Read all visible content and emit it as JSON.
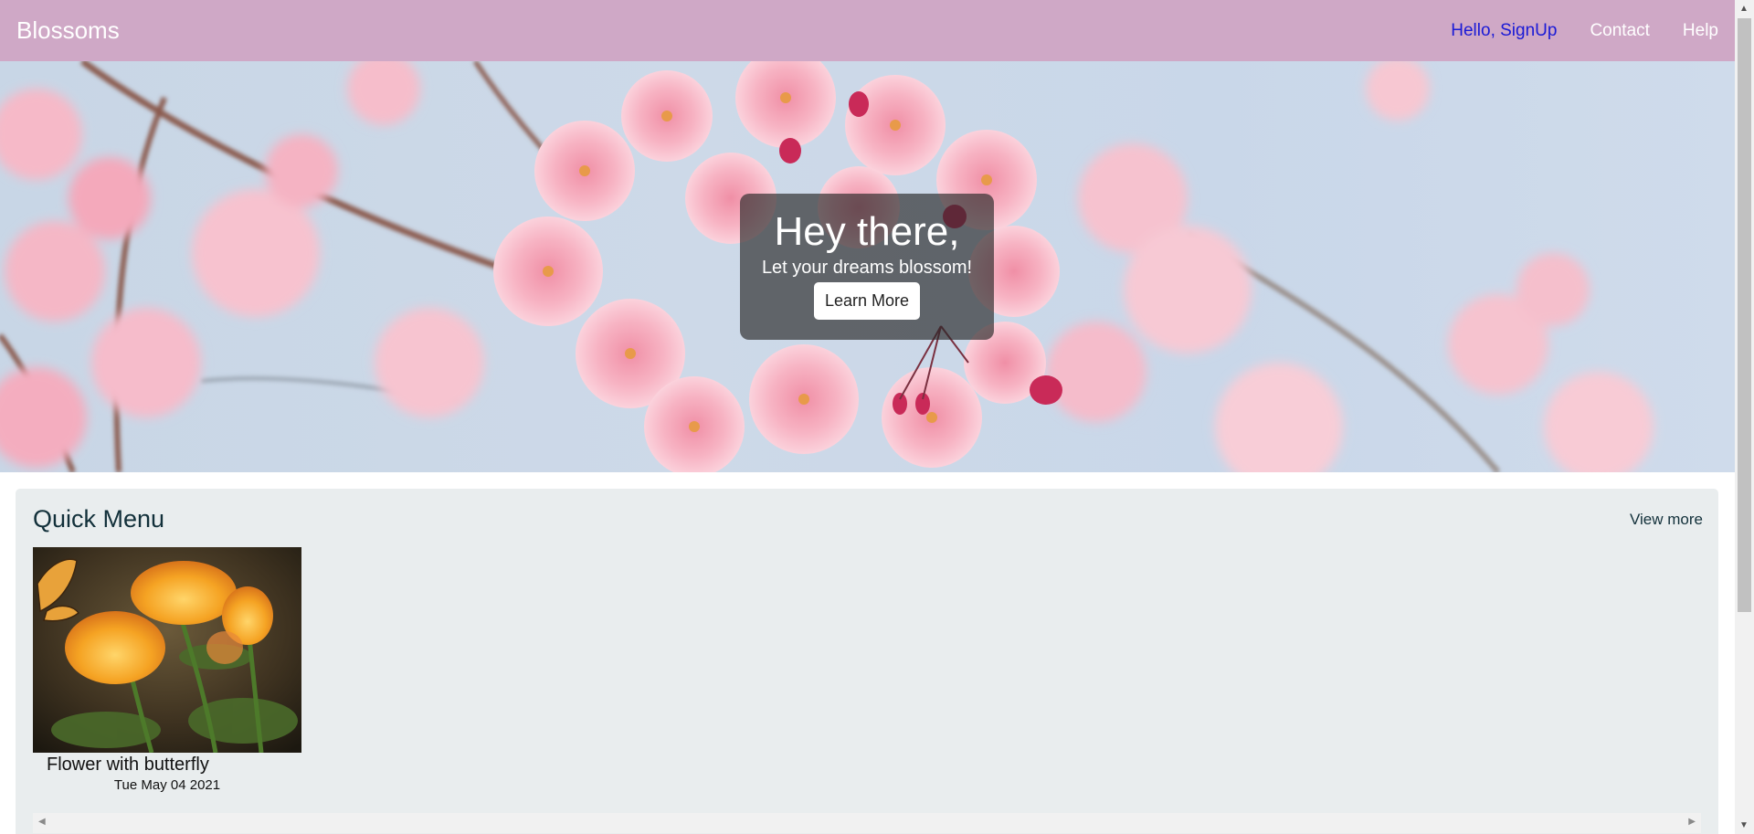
{
  "navbar": {
    "brand": "Blossoms",
    "links": [
      {
        "label": "Hello, SignUp"
      },
      {
        "label": "Contact"
      },
      {
        "label": "Help"
      }
    ]
  },
  "hero": {
    "title": "Hey there,",
    "subtitle": "Let your dreams blossom!",
    "button_label": "Learn More"
  },
  "quick_menu": {
    "title": "Quick Menu",
    "view_more": "View more",
    "items": [
      {
        "title": "Flower with butterfly",
        "date": "Tue May 04 2021"
      }
    ]
  },
  "colors": {
    "navbar_bg": "#cfa8c6",
    "active_link": "#1a1ad6",
    "panel_bg": "#e9edee"
  }
}
